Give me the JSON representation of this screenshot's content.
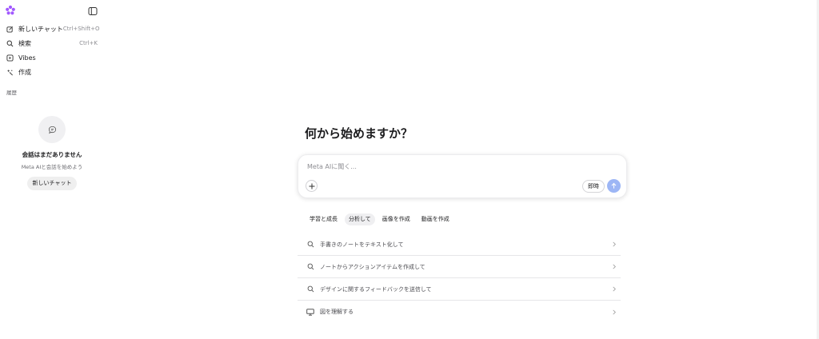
{
  "sidebar": {
    "logo_icon": "meta-ai-flower-logo",
    "collapse_icon": "sidebar-toggle-icon",
    "nav": [
      {
        "icon": "new-chat-icon",
        "label": "新しいチャット",
        "shortcut": "Ctrl+Shift+O"
      },
      {
        "icon": "search-icon",
        "label": "検索",
        "shortcut": "Ctrl+K"
      },
      {
        "icon": "play-icon",
        "label": "Vibes",
        "shortcut": ""
      },
      {
        "icon": "sparkle-icon",
        "label": "作成",
        "shortcut": ""
      }
    ],
    "history_label": "履歴",
    "empty_state": {
      "icon": "chat-bubble-icon",
      "title": "会話はまだありません",
      "subtitle": "Meta AIと会話を始めよう",
      "button": "新しいチャット"
    }
  },
  "main": {
    "heading": "何から始めますか？",
    "composer": {
      "placeholder": "Meta AIに聞く...",
      "value": "",
      "mode_button": "即時",
      "add_icon": "plus-icon",
      "send_icon": "arrow-up-icon"
    },
    "chips": [
      {
        "label": "学習と成長",
        "selected": false
      },
      {
        "label": "分析して",
        "selected": true
      },
      {
        "label": "画像を作成",
        "selected": false
      },
      {
        "label": "動画を作成",
        "selected": false
      }
    ],
    "suggestions": [
      {
        "icon": "search-icon",
        "label": "手書きのノートをテキスト化して"
      },
      {
        "icon": "search-icon",
        "label": "ノートからアクションアイテムを作成して"
      },
      {
        "icon": "search-icon",
        "label": "デザインに関するフィードバックを送信して"
      },
      {
        "icon": "monitor-icon",
        "label": "図を理解する"
      }
    ]
  },
  "colors": {
    "accent_send": "#9db6f5",
    "logo": "#a259ff",
    "chip_active_bg": "#efeff1"
  }
}
